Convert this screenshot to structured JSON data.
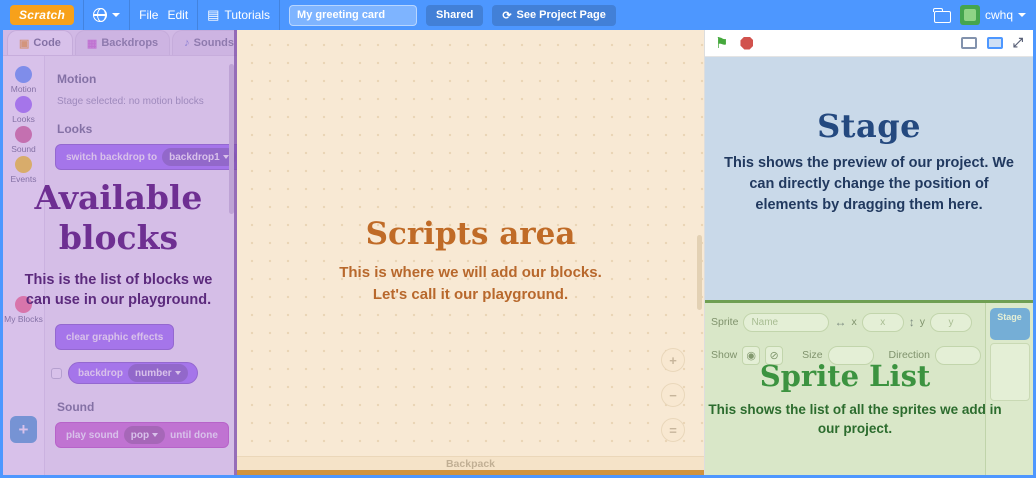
{
  "colors": {
    "menubar_blue": "#4d97ff",
    "looks_purple": "#9966ff",
    "sound_magenta": "#cf63cf",
    "overlay_purple": "#b184d6",
    "overlay_orange": "#f3dbba",
    "overlay_blue": "#c9d9e9",
    "overlay_green": "#b8d592"
  },
  "menubar": {
    "logo_text": "Scratch",
    "menus": {
      "file": "File",
      "edit": "Edit",
      "tutorials": "Tutorials"
    },
    "project_name": "My greeting card",
    "shared_label": "Shared",
    "see_project_icon": "⟳",
    "see_project_label": "See Project Page",
    "username": "cwhq"
  },
  "tabs": [
    {
      "label": "Code"
    },
    {
      "label": "Backdrops"
    },
    {
      "label": "Sounds"
    }
  ],
  "categories": [
    {
      "label": "Motion",
      "color": "#4c97ff"
    },
    {
      "label": "Looks",
      "color": "#9966ff"
    },
    {
      "label": "Sound",
      "color": "#d65c8a"
    },
    {
      "label": "Events",
      "color": "#ffd500"
    },
    {
      "label": "My Blocks",
      "color": "#ff6680"
    }
  ],
  "palette": {
    "motion_header": "Motion",
    "motion_empty": "Stage selected: no motion blocks",
    "looks_header": "Looks",
    "switch_backdrop": {
      "text": "switch backdrop to",
      "value": "backdrop1"
    },
    "clear_effects": {
      "text": "clear graphic effects"
    },
    "backdrop_reporter": {
      "text": "backdrop",
      "value": "number"
    },
    "sound_header": "Sound",
    "play_sound": {
      "text": "play sound",
      "value": "pop",
      "suffix": "until done"
    }
  },
  "scripts": {
    "backpack_label": "Backpack",
    "zoom_in": "+",
    "zoom_out": "−",
    "zoom_reset": "="
  },
  "sprite_panel": {
    "sprite_label": "Sprite",
    "name_placeholder": "Name",
    "x_arrow": "↔",
    "x_label": "x",
    "x_placeholder": "x",
    "y_arrow": "↕",
    "y_label": "y",
    "y_placeholder": "y",
    "show_label": "Show",
    "show_icon": "◉",
    "hide_icon": "⊘",
    "size_label": "Size",
    "direction_label": "Direction",
    "stage_card_label": "Stage"
  },
  "overlays": {
    "blocks": {
      "title": "Available blocks",
      "body": "This is the list of blocks we can use in our playground."
    },
    "scripts": {
      "title": "Scripts area",
      "line1": "This is where we will add our blocks.",
      "line2": "Let's call it our playground."
    },
    "stage": {
      "title": "Stage",
      "body": "This shows the preview of our project. We can directly change the position of elements by dragging them here."
    },
    "sprites": {
      "title": "Sprite List",
      "body": "This shows the list of all the sprites we add in our project."
    }
  }
}
